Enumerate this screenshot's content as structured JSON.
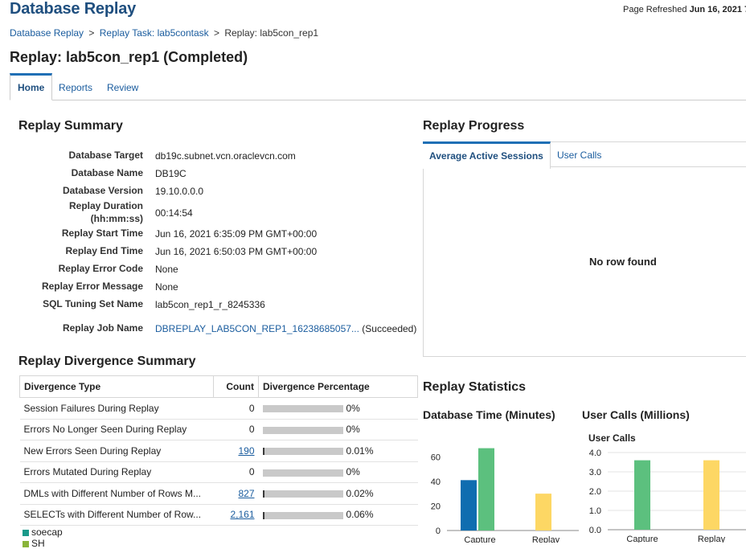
{
  "app_title": "Database Replay",
  "refresh": {
    "label": "Page Refreshed",
    "value": "Jun 16, 2021 7"
  },
  "breadcrumb": {
    "items": [
      "Database Replay",
      "Replay Task: lab5contask"
    ],
    "current": "Replay: lab5con_rep1",
    "separator": ">"
  },
  "page_title": "Replay: lab5con_rep1 (Completed)",
  "tabs": [
    "Home",
    "Reports",
    "Review"
  ],
  "summary": {
    "title": "Replay Summary",
    "rows": [
      {
        "label": "Database Target",
        "value": "db19c.subnet.vcn.oraclevcn.com",
        "link": true
      },
      {
        "label": "Database Name",
        "value": "DB19C"
      },
      {
        "label": "Database Version",
        "value": "19.10.0.0.0"
      },
      {
        "label": "Replay Duration",
        "label2": "(hh:mm:ss)",
        "value": "00:14:54"
      },
      {
        "label": "Replay Start Time",
        "value": "Jun 16, 2021 6:35:09 PM GMT+00:00"
      },
      {
        "label": "Replay End Time",
        "value": "Jun 16, 2021 6:50:03 PM GMT+00:00"
      },
      {
        "label": "Replay Error Code",
        "value": "None"
      },
      {
        "label": "Replay Error Message",
        "value": "None"
      },
      {
        "label": "SQL Tuning Set Name",
        "value": "lab5con_rep1_r_8245336"
      },
      {
        "label": "Replay Job Name",
        "value": "DBREPLAY_LAB5CON_REP1_16238685057...",
        "link": true,
        "suffix": "(Succeeded)"
      }
    ]
  },
  "divergence": {
    "title": "Replay Divergence Summary",
    "headers": [
      "Divergence Type",
      "Count",
      "Divergence Percentage"
    ],
    "rows": [
      {
        "type": "Session Failures During Replay",
        "count": "0",
        "link": false,
        "pct": "0%",
        "fraction": 0
      },
      {
        "type": "Errors No Longer Seen During Replay",
        "count": "0",
        "link": false,
        "pct": "0%",
        "fraction": 0
      },
      {
        "type": "New Errors Seen During Replay",
        "count": "190",
        "link": true,
        "pct": "0.01%",
        "fraction": 0.0001
      },
      {
        "type": "Errors Mutated During Replay",
        "count": "0",
        "link": false,
        "pct": "0%",
        "fraction": 0
      },
      {
        "type": "DMLs with Different Number of Rows M...",
        "count": "827",
        "link": true,
        "pct": "0.02%",
        "fraction": 0.0002
      },
      {
        "type": "SELECTs with Different Number of Row...",
        "count": "2,161",
        "link": true,
        "pct": "0.06%",
        "fraction": 0.0006
      }
    ]
  },
  "legend": [
    {
      "label": "soecap",
      "color": "#1a9a8a"
    },
    {
      "label": "SH",
      "color": "#8ab43a"
    }
  ],
  "progress": {
    "title": "Replay Progress",
    "tabs": [
      "Average Active Sessions",
      "User Calls"
    ],
    "empty_text": "No row found"
  },
  "statistics": {
    "title": "Replay Statistics",
    "db_time_title": "Database Time (Minutes)",
    "user_calls_title": "User Calls (Millions)"
  },
  "chart_data": [
    {
      "type": "bar",
      "categories": [
        "Capture",
        "Replay"
      ],
      "ylim": [
        0,
        70
      ],
      "yticks": [
        0,
        20,
        40,
        60
      ],
      "series": [
        {
          "values": [
            41,
            0
          ],
          "color": "#0f6db0"
        },
        {
          "values": [
            67,
            0
          ],
          "color": "#5cc07e"
        },
        {
          "values": [
            0,
            30
          ],
          "color": "#fdd764"
        }
      ]
    },
    {
      "type": "bar",
      "title": "User Calls",
      "categories": [
        "Capture",
        "Replay"
      ],
      "ylim": [
        0,
        4.0
      ],
      "yticks": [
        0.0,
        1.0,
        2.0,
        3.0,
        4.0
      ],
      "ytick_labels": [
        "0.0",
        "1.0",
        "2.0",
        "3.0",
        "4.0"
      ],
      "series": [
        {
          "values": [
            3.6,
            0
          ],
          "color": "#5cc07e"
        },
        {
          "values": [
            0,
            3.6
          ],
          "color": "#fdd764"
        }
      ]
    }
  ]
}
